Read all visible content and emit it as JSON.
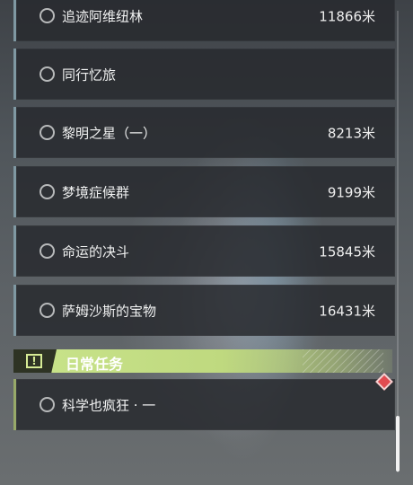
{
  "main_quests": [
    {
      "name": "追迹阿维纽林",
      "distance": "11866米"
    },
    {
      "name": "同行忆旅",
      "distance": ""
    },
    {
      "name": "黎明之星（一）",
      "distance": "8213米"
    },
    {
      "name": "梦境症候群",
      "distance": "9199米"
    },
    {
      "name": "命运的决斗",
      "distance": "15845米"
    },
    {
      "name": "萨姆沙斯的宝物",
      "distance": "16431米"
    }
  ],
  "daily_section": {
    "title": "日常任务",
    "icon": "exclamation-icon",
    "accent_color": "#c3dd84"
  },
  "daily_quests": [
    {
      "name": "科学也疯狂 · 一",
      "distance": "",
      "marker": "red-diamond-icon"
    }
  ],
  "colors": {
    "main_stripe": "#7f98a2",
    "daily_stripe": "#97a969",
    "marker": "#e14b50"
  }
}
